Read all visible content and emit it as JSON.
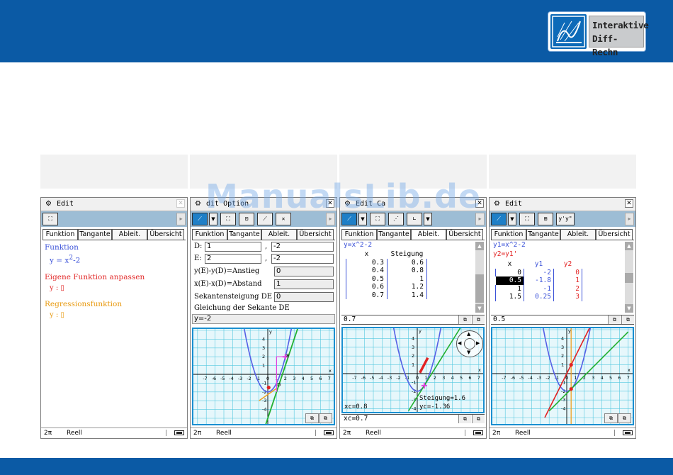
{
  "header": {
    "logo_line1": "Interaktive",
    "logo_line2": "Diff-Rechn"
  },
  "watermark": "ManualsLib.de",
  "screens": [
    {
      "title": "Edit",
      "tabs": [
        "Funktion",
        "Tangante",
        "Ableit.",
        "Übersicht"
      ],
      "selected_tab": 0,
      "heading": "Funktion",
      "function_prefix": "y = x",
      "function_exp": "2",
      "function_suffix": "-2",
      "own_function_heading": "Eigene Funktion anpassen",
      "own_function_value": "y : ▯",
      "regression_heading": "Regressionsfunktion",
      "regression_value": "y : ▯",
      "status_angle": "2π",
      "status_mode": "Reell"
    },
    {
      "title": "dit Option",
      "tabs": [
        "Funktion",
        "Tangante",
        "Ableit.",
        "Übersicht"
      ],
      "selected_tab": 1,
      "d_label": "D:",
      "d_x": "1",
      "d_sep": ",",
      "d_y": "-2",
      "e_label": "E:",
      "e_x": "2",
      "e_sep": ",",
      "e_y": "-2",
      "rise_label": "y(E)-y(D)=Anstieg",
      "rise_value": "0",
      "dist_label": "x(E)-x(D)=Abstand",
      "dist_value": "1",
      "slope_label": "Sekantensteigung DE",
      "slope_value": "0",
      "eq_label": "Gleichung der Sekante DE",
      "eq_value": "y=-2",
      "point_e": "E",
      "point_d": "D",
      "status_angle": "2π",
      "status_mode": "Reell"
    },
    {
      "title": "Edit Ca",
      "tabs": [
        "Funktion",
        "Tangante",
        "Ableit.",
        "Übersicht"
      ],
      "selected_tab": 2,
      "function": "y=x^2-2",
      "col_x": "x",
      "col_slope": "Steigung",
      "rows": [
        [
          "0.3",
          "0.6"
        ],
        [
          "0.4",
          "0.8"
        ],
        [
          "0.5",
          "1"
        ],
        [
          "0.6",
          "1.2"
        ],
        [
          "0.7",
          "1.4"
        ]
      ],
      "input_value": "0.7",
      "trace_slope": "Steigung=1.6",
      "trace_xc": "xc=0.8",
      "trace_yc": "yc=-1.36",
      "graph_input": "xc=0.7",
      "status_angle": "2π",
      "status_mode": "Reell"
    },
    {
      "title": "Edit",
      "tabs": [
        "Funktion",
        "Tangante",
        "Ableit.",
        "Übersicht"
      ],
      "selected_tab": 3,
      "y1_def": "y1=x^2-2",
      "y2_def": "y2=y1'",
      "col_x": "x",
      "col_y1": "y1",
      "col_y2": "y2",
      "rows": [
        [
          "0",
          "-2",
          "0"
        ],
        [
          "0.5",
          "-1.8",
          "1"
        ],
        [
          "1",
          "-1",
          "2"
        ],
        [
          "1.5",
          "0.25",
          "3"
        ]
      ],
      "input_value": "0.5",
      "status_angle": "2π",
      "status_mode": "Reell"
    }
  ],
  "axis_ticks": [
    "-7",
    "-6",
    "-5",
    "-4",
    "-3",
    "-2",
    "-1",
    "0",
    "1",
    "2",
    "3",
    "4",
    "5",
    "6",
    "7"
  ],
  "axis_ticks_y": [
    "4",
    "3",
    "2",
    "1",
    "-1",
    "-2",
    "-3",
    "-4"
  ],
  "axis_label_x": "x",
  "axis_label_y": "y",
  "colors": {
    "header_blue": "#0b5aa5",
    "parabola": "#5560e6",
    "line_green": "#22b030",
    "line_red": "#e22222",
    "magenta": "#e040e0",
    "orange": "#f0a020",
    "grid_bg": "#e6f7fb",
    "grid_line": "#55c8e0",
    "toolbar": "#9dbdd5"
  }
}
